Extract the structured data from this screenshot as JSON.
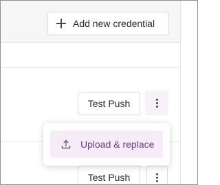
{
  "toolbar": {
    "add_credential_label": "Add new credential",
    "add_icon": "plus-icon"
  },
  "rows": [
    {
      "test_push_label": "Test Push",
      "more_icon": "more-vertical-icon"
    },
    {
      "test_push_label": "Test Push",
      "more_icon": "more-vertical-icon"
    }
  ],
  "menu": {
    "items": [
      {
        "label": "Upload & replace",
        "icon": "upload-icon"
      }
    ]
  },
  "colors": {
    "accent_text": "#6b3a86",
    "accent_bg": "#f6ecf8",
    "toolbar_bg": "#f6f6f6"
  }
}
